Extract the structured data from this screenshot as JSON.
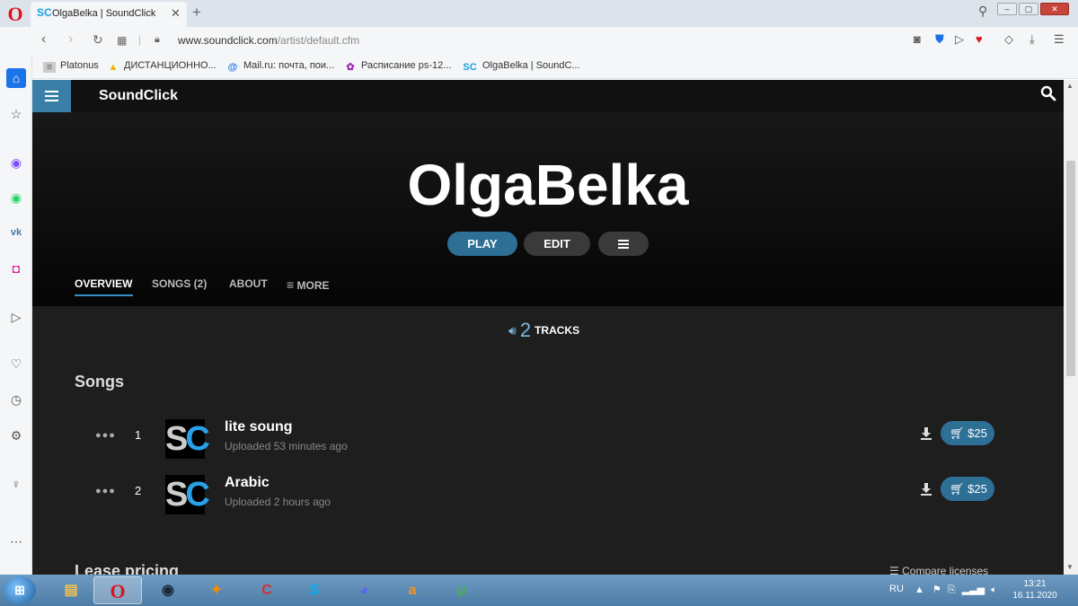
{
  "browser": {
    "tab_title": "OlgaBelka | SoundClick",
    "tab_favicon": "SC",
    "url_domain": "www.soundclick.com",
    "url_path": "/artist/default.cfm",
    "bookmarks": [
      {
        "label": "Platonus"
      },
      {
        "label": "ДИСТАНЦИОННО..."
      },
      {
        "label": "Mail.ru: почта, пои..."
      },
      {
        "label": "Расписание ps-12..."
      },
      {
        "label": "OlgaBelka | SoundC..."
      }
    ]
  },
  "site": {
    "brand": "SoundClick"
  },
  "artist": {
    "name": "OlgaBelka",
    "play_label": "PLAY",
    "edit_label": "EDIT"
  },
  "page_nav": {
    "overview": "OVERVIEW",
    "songs": "SONGS (2)",
    "about": "ABOUT",
    "more": "MORE"
  },
  "stats": {
    "track_count": "2",
    "track_label": "TRACKS"
  },
  "songs": {
    "heading": "Songs",
    "items": [
      {
        "index": "1",
        "art": "SC",
        "title": "lite soung",
        "uploaded": "Uploaded 53 minutes ago",
        "price": "$25"
      },
      {
        "index": "2",
        "art": "SC",
        "title": "Arabic",
        "uploaded": "Uploaded 2 hours ago",
        "price": "$25"
      }
    ]
  },
  "lease": {
    "heading": "Lease pricing",
    "compare_label": "Compare licenses"
  },
  "taskbar": {
    "lang": "RU",
    "time": "13:21",
    "date": "16.11.2020"
  },
  "colors": {
    "accent": "#2e6f96",
    "brand_blue": "#29a0e8",
    "page_bg": "#1e1e1e"
  }
}
